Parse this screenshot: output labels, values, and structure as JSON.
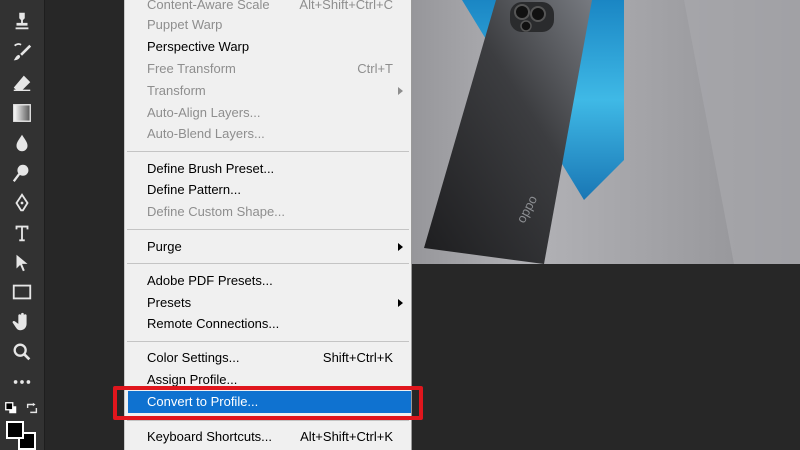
{
  "menu": {
    "items": [
      {
        "label": "Content-Aware Scale",
        "shortcut": "Alt+Shift+Ctrl+C",
        "disabled": true,
        "submenu": false
      },
      {
        "label": "Puppet Warp",
        "shortcut": "",
        "disabled": true,
        "submenu": false
      },
      {
        "label": "Perspective Warp",
        "shortcut": "",
        "disabled": false,
        "submenu": false
      },
      {
        "label": "Free Transform",
        "shortcut": "Ctrl+T",
        "disabled": true,
        "submenu": false
      },
      {
        "label": "Transform",
        "shortcut": "",
        "disabled": true,
        "submenu": true
      },
      {
        "label": "Auto-Align Layers...",
        "shortcut": "",
        "disabled": true,
        "submenu": false
      },
      {
        "label": "Auto-Blend Layers...",
        "shortcut": "",
        "disabled": true,
        "submenu": false
      },
      {
        "label": "Define Brush Preset...",
        "shortcut": "",
        "disabled": false,
        "submenu": false
      },
      {
        "label": "Define Pattern...",
        "shortcut": "",
        "disabled": false,
        "submenu": false
      },
      {
        "label": "Define Custom Shape...",
        "shortcut": "",
        "disabled": true,
        "submenu": false
      },
      {
        "label": "Purge",
        "shortcut": "",
        "disabled": false,
        "submenu": true
      },
      {
        "label": "Adobe PDF Presets...",
        "shortcut": "",
        "disabled": false,
        "submenu": false
      },
      {
        "label": "Presets",
        "shortcut": "",
        "disabled": false,
        "submenu": true
      },
      {
        "label": "Remote Connections...",
        "shortcut": "",
        "disabled": false,
        "submenu": false
      },
      {
        "label": "Color Settings...",
        "shortcut": "Shift+Ctrl+K",
        "disabled": false,
        "submenu": false
      },
      {
        "label": "Assign Profile...",
        "shortcut": "",
        "disabled": false,
        "submenu": false
      },
      {
        "label": "Convert to Profile...",
        "shortcut": "",
        "disabled": false,
        "submenu": false,
        "highlighted": true
      },
      {
        "label": "Keyboard Shortcuts...",
        "shortcut": "Alt+Shift+Ctrl+K",
        "disabled": false,
        "submenu": false
      }
    ]
  },
  "toolbar": {
    "tools": [
      "stamp-icon",
      "history-brush-icon",
      "eraser-icon",
      "gradient-icon",
      "blur-drop-icon",
      "dodge-icon",
      "pen-icon",
      "type-icon",
      "path-selection-icon",
      "rectangle-icon",
      "hand-icon",
      "zoom-icon",
      "more-tools-icon"
    ]
  },
  "canvas": {
    "phone_brand": "oppo"
  },
  "colors": {
    "menu_bg": "#f0f0f0",
    "highlight": "#0f72d0",
    "callout": "#e0161d",
    "toolbar_bg": "#323232"
  }
}
